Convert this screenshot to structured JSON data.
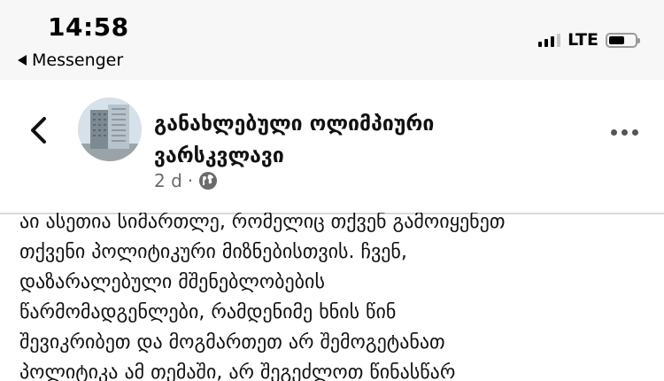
{
  "status_bar": {
    "time": "14:58",
    "back_app_label": "Messenger",
    "network": "LTE",
    "battery_level": 0.6
  },
  "post": {
    "page_name": "განახლებული ოლიმპიური ვარსკვლავი",
    "time_ago": "2 d",
    "separator": "·",
    "audience_icon": "globe-icon",
    "text": "აი ასეთია სიმართლე, რომელიც  თქვენ გამოიყენეთ\nთქვენი პოლიტიკური მიზნებისთვის. ჩვენ,\nდაზარალებული მშენებლობების\nწარმომადგენლები, რამდენიმე ხნის წინ\nშევიკრიბეთ და მოგმართეთ არ შემოგეტანათ\nპოლიტიკა ამ თემაში, არ შეგეძლოთ წინასწარ"
  },
  "icons": {
    "back": "chevron-left-icon",
    "more": "more-horizontal-icon"
  }
}
